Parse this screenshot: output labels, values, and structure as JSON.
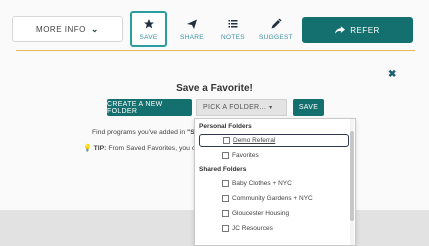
{
  "toolbar": {
    "more_info": "MORE INFO",
    "save": "SAVE",
    "share": "SHARE",
    "notes": "NOTES",
    "suggest": "SUGGEST",
    "refer": "REFER"
  },
  "dialog": {
    "title": "Save a Favorite!",
    "create_folder": "CREATE A NEW FOLDER",
    "pick_folder": "PICK A FOLDER...",
    "save": "SAVE",
    "info_line": "Find programs you've added in",
    "info_bold": "\"Sav",
    "tip_label": "TIP:",
    "tip_text": "From Saved Favorites, you can",
    "tip_bold": "e"
  },
  "dropdown": {
    "personal_header": "Personal Folders",
    "personal": [
      "Demo Referral",
      "Favorites"
    ],
    "shared_header": "Shared Folders",
    "shared": [
      "Baby Clothes + NYC",
      "Community Gardens + NYC",
      "Gloucester Housing",
      "JC Resources"
    ]
  },
  "colors": {
    "primary": "#14706f",
    "accent_teal": "#2a9e9e",
    "divider_gold": "#e2bb5a"
  },
  "icons": {
    "save": "star-icon",
    "share": "paper-plane-icon",
    "notes": "list-icon",
    "suggest": "pencil-icon",
    "refer": "share-arrow-icon",
    "close": "close-icon"
  }
}
